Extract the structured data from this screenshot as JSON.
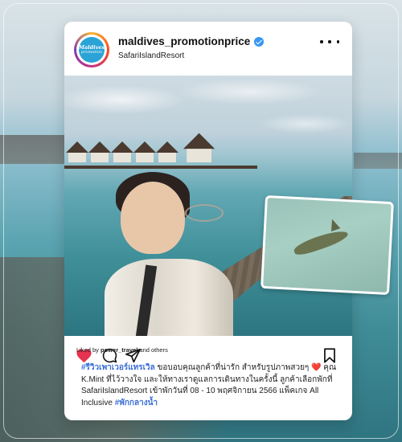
{
  "post": {
    "username": "maldives_promotionprice",
    "location": "SafariIslandResort",
    "avatar": {
      "line1": "Maldives",
      "line2": "promotion"
    },
    "liked_by": {
      "prefix": "Liked by ",
      "user": "power_travel",
      "suffix": " and others"
    },
    "caption": {
      "hashtag1": "#รีวิวเพาเวอร์แทรเวิล",
      "text1": " ขอบอบคุณลูกค้าที่น่ารัก สำหรับรูปภาพสวยๆ ",
      "heart": "❤️",
      "text2": " คุณ K.Mint ที่ไว้วางใจ และให้ทางเราดูแลการเดินทางในครั้งนี้ ลูกค้าเลือกพักที่ SafariIslandResort เข้าพักวันที่  08 - 10 พฤศจิกายน 2566 แพ็คเกจ All Inclusive ",
      "hashtag2": "#พักกลางน้ำ"
    }
  },
  "colors": {
    "verified": "#3897f0",
    "heart": "#e6334f",
    "hashtag": "#3b6fd6"
  },
  "icons": [
    "verified-badge-icon",
    "more-options-icon",
    "heart-icon",
    "comment-icon",
    "share-icon",
    "bookmark-icon"
  ]
}
